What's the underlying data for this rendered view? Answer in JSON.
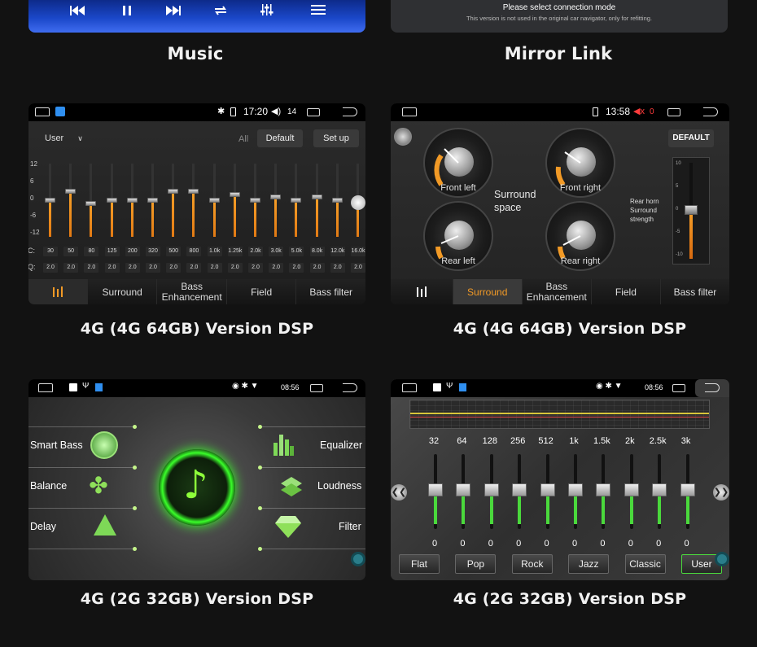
{
  "captions": {
    "music": "Music",
    "mirror": "Mirror Link",
    "dsp1": "4G (4G 64GB) Version DSP",
    "dsp2": "4G (4G 64GB) Version DSP",
    "dsp3": "4G (2G 32GB) Version DSP",
    "dsp4": "4G (2G 32GB) Version DSP"
  },
  "mirror": {
    "title": "Please select connection mode",
    "note": "This version is not used in the original car navigator, only for refitting."
  },
  "eq1": {
    "status_time": "17:20",
    "status_volume": "14",
    "preset": "User",
    "all_label": "All",
    "default_btn": "Default",
    "setup_btn": "Set up",
    "y_ticks": [
      "12",
      "6",
      "0",
      "-6",
      "-12"
    ],
    "row_c_label": "C:",
    "row_q_label": "Q:",
    "freqs": [
      "30",
      "50",
      "80",
      "125",
      "200",
      "320",
      "500",
      "800",
      "1.0k",
      "1.25k",
      "2.0k",
      "3.0k",
      "5.0k",
      "8.0k",
      "12.0k",
      "16.0k"
    ],
    "q_values": [
      "2.0",
      "2.0",
      "2.0",
      "2.0",
      "2.0",
      "2.0",
      "2.0",
      "2.0",
      "2.0",
      "2.0",
      "2.0",
      "2.0",
      "2.0",
      "2.0",
      "2.0",
      "2.0"
    ],
    "tabs": [
      "Surround",
      "Bass Enhancement",
      "Field",
      "Bass filter"
    ]
  },
  "eq1_levels_db": [
    0,
    3,
    -1,
    0,
    0,
    0,
    3,
    3,
    0,
    2,
    0,
    1,
    0,
    1,
    0,
    0
  ],
  "surround": {
    "status_time": "13:58",
    "status_volume": "0",
    "default_btn": "DEFAULT",
    "labels": {
      "front_left": "Front left",
      "front_right": "Front right",
      "rear_left": "Rear left",
      "rear_right": "Rear right",
      "center": "Surround space",
      "horn": "Rear horn Surround strength"
    },
    "scale": [
      "10",
      "5",
      "0",
      "-5",
      "-10"
    ],
    "tabs": [
      "Surround",
      "Bass Enhancement",
      "Field",
      "Bass filter"
    ],
    "active_tab": "Surround"
  },
  "dsp": {
    "status_time": "08:56",
    "items_left": [
      "Smart Bass",
      "Balance",
      "Delay"
    ],
    "items_right": [
      "Equalizer",
      "Loudness",
      "Filter"
    ]
  },
  "eq2": {
    "status_time": "08:56",
    "freqs": [
      "32",
      "64",
      "128",
      "256",
      "512",
      "1k",
      "1.5k",
      "2k",
      "2.5k",
      "3k"
    ],
    "values": [
      "0",
      "0",
      "0",
      "0",
      "0",
      "0",
      "0",
      "0",
      "0",
      "0"
    ],
    "presets": [
      "Flat",
      "Pop",
      "Rock",
      "Jazz",
      "Classic",
      "User"
    ],
    "active_preset": "User"
  },
  "colors": {
    "accent_orange": "#f29a26",
    "accent_green": "#7dff3a",
    "bg": "#121212"
  }
}
